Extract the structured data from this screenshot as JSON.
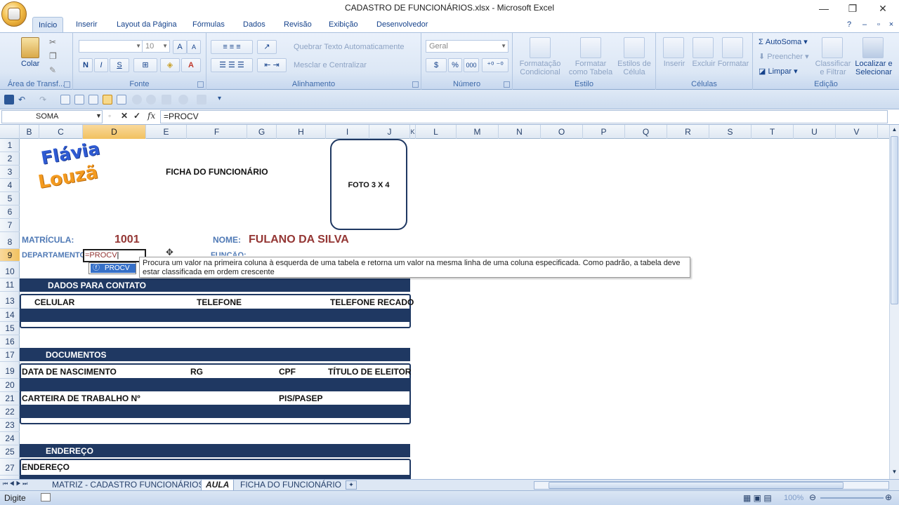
{
  "window": {
    "title": "CADASTRO DE FUNCIONÁRIOS.xlsx - Microsoft Excel",
    "controls": [
      "—",
      "❐",
      "✕"
    ]
  },
  "ribbon_tabs": [
    "Início",
    "Inserir",
    "Layout da Página",
    "Fórmulas",
    "Dados",
    "Revisão",
    "Exibição",
    "Desenvolvedor"
  ],
  "ribbon": {
    "clipboard": {
      "paste": "Colar",
      "group": "Área de Transf..."
    },
    "font": {
      "name": "",
      "size": "10",
      "group": "Fonte",
      "bold": "N",
      "italic": "I",
      "underline": "S"
    },
    "alignment": {
      "wrap": "Quebrar Texto Automaticamente",
      "merge": "Mesclar e Centralizar",
      "group": "Alinhamento"
    },
    "number": {
      "format": "Geral",
      "percent": "%",
      "thousands": "000",
      "group": "Número"
    },
    "styles": {
      "conditional": "Formatação Condicional",
      "as_table": "Formatar como Tabela",
      "cell_styles": "Estilos de Célula",
      "group": "Estilo"
    },
    "cells": {
      "insert": "Inserir",
      "delete": "Excluir",
      "format": "Formatar",
      "group": "Células"
    },
    "editing": {
      "autosum": "AutoSoma",
      "fill": "Preencher",
      "clear": "Limpar",
      "sort": "Classificar e Filtrar",
      "find": "Localizar e Selecionar",
      "group": "Edição"
    }
  },
  "formula_bar": {
    "name_box": "SOMA",
    "fx": "fx",
    "formula": "=PROCV"
  },
  "columns": [
    "B",
    "C",
    "D",
    "E",
    "F",
    "G",
    "H",
    "I",
    "J",
    "K",
    "L",
    "M",
    "N",
    "O",
    "P",
    "Q",
    "R",
    "S",
    "T",
    "U",
    "V"
  ],
  "rows": [
    "1",
    "2",
    "3",
    "4",
    "5",
    "6",
    "7",
    "8",
    "9",
    "10",
    "11",
    "13",
    "14",
    "15",
    "16",
    "17",
    "19",
    "20",
    "21",
    "22",
    "23",
    "24",
    "25",
    "27"
  ],
  "sheet": {
    "logo_line1": "Flávia",
    "logo_line2": "Louzã",
    "title": "FICHA DO FUNCIONÁRIO",
    "photo": "FOTO 3 X 4",
    "matricula_label": "MATRÍCULA:",
    "matricula_value": "1001",
    "nome_label": "NOME:",
    "nome_value": "FULANO DA SILVA",
    "departamento_label": "DEPARTAMENTO:",
    "departamento_edit": "=PROCV",
    "funcao_label": "FUNÇÃO:",
    "contato_header": "DADOS PARA CONTATO",
    "celular": "CELULAR",
    "telefone": "TELEFONE",
    "telefone_recado": "TELEFONE RECADO",
    "documentos_header": "DOCUMENTOS",
    "data_nascimento": "DATA DE NASCIMENTO",
    "rg": "RG",
    "cpf": "CPF",
    "titulo_eleitor": "TÍTULO DE ELEITOR",
    "carteira": "CARTEIRA DE TRABALHO Nº",
    "pis": "PIS/PASEP",
    "endereco_header": "ENDEREÇO",
    "endereco": "ENDEREÇO"
  },
  "autocomplete": {
    "item": "PROCV",
    "tooltip": "Procura um valor na primeira coluna à esquerda de uma tabela e retorna um valor na mesma linha de uma coluna especificada. Como padrão, a tabela deve estar classificada em ordem crescente"
  },
  "sheet_tabs": [
    "MATRIZ - CADASTRO FUNCIONÁRIOS",
    "AULA",
    "FICHA DO FUNCIONÁRIO"
  ],
  "status": {
    "mode": "Digite",
    "zoom": "100%"
  },
  "colors": {
    "navy": "#1f3862",
    "label_blue": "#4f79b5",
    "value_red": "#943634",
    "selection": "#f1c15f"
  }
}
